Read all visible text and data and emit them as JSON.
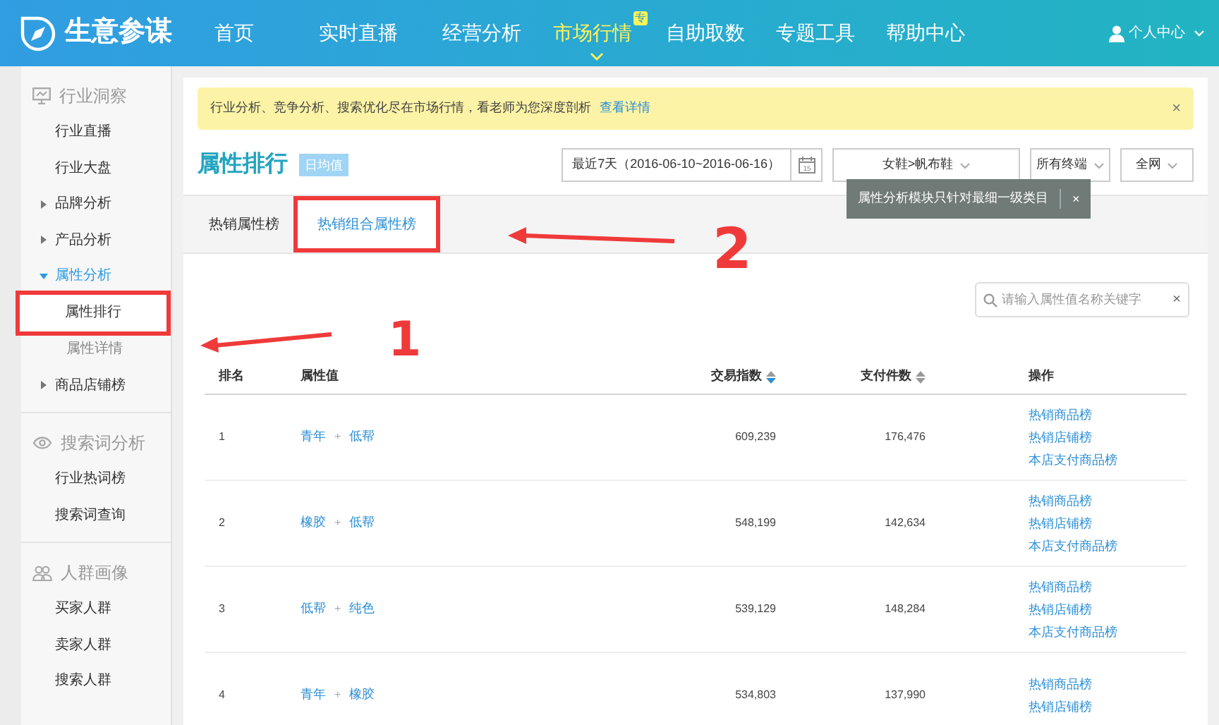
{
  "header": {
    "logo": "生意参谋",
    "nav": [
      {
        "label": "首页",
        "selected": false
      },
      {
        "label": "实时直播",
        "selected": false
      },
      {
        "label": "经营分析",
        "selected": false
      },
      {
        "label": "市场行情",
        "selected": true,
        "badge": "专"
      },
      {
        "label": "自助取数",
        "selected": false
      },
      {
        "label": "专题工具",
        "selected": false
      },
      {
        "label": "帮助中心",
        "selected": false
      }
    ],
    "user": "个人中心"
  },
  "sidebar": {
    "sections": [
      {
        "title": "行业洞察",
        "items": [
          {
            "label": "行业直播"
          },
          {
            "label": "行业大盘"
          },
          {
            "label": "品牌分析",
            "expanded": false
          },
          {
            "label": "产品分析",
            "expanded": false
          },
          {
            "label": "属性分析",
            "expanded": true,
            "children": [
              {
                "label": "属性排行",
                "selected": true,
                "annotated": true
              },
              {
                "label": "属性详情",
                "selected": false,
                "annotated": false
              }
            ]
          },
          {
            "label": "商品店铺榜",
            "expanded": false
          }
        ]
      },
      {
        "title": "搜索词分析",
        "items": [
          {
            "label": "行业热词榜"
          },
          {
            "label": "搜索词查询"
          }
        ]
      },
      {
        "title": "人群画像",
        "items": [
          {
            "label": "买家人群"
          },
          {
            "label": "卖家人群"
          },
          {
            "label": "搜索人群"
          }
        ]
      }
    ]
  },
  "notice": {
    "text": "行业分析、竞争分析、搜索优化尽在市场行情，看老师为您深度剖析",
    "link": "查看详情",
    "close": "×"
  },
  "page": {
    "title": "属性排行",
    "tag": "日均值",
    "date_range": "最近7天（2016-06-10~2016-06-16）",
    "calendar_day": "15",
    "category": "女鞋>帆布鞋",
    "terminal": "所有终端",
    "channel": "全网"
  },
  "tooltip": {
    "text": "属性分析模块只针对最细一级类目",
    "close": "×"
  },
  "tabs": [
    {
      "label": "热销属性榜",
      "selected": false,
      "annotated": false
    },
    {
      "label": "热销组合属性榜",
      "selected": true,
      "annotated": true
    }
  ],
  "search": {
    "placeholder": "请输入属性值名称关键字",
    "clear": "×"
  },
  "table": {
    "columns": [
      {
        "label": "排名"
      },
      {
        "label": "属性值"
      },
      {
        "label": "交易指数",
        "sorted": true
      },
      {
        "label": "支付件数",
        "sorted": false
      },
      {
        "label": "操作"
      }
    ],
    "joiner": "+",
    "rows": [
      {
        "rank": "1",
        "parts": [
          "青年",
          "低帮"
        ],
        "index": "609,239",
        "paid": "176,476",
        "actions": [
          "热销商品榜",
          "热销店铺榜",
          "本店支付商品榜"
        ]
      },
      {
        "rank": "2",
        "parts": [
          "橡胶",
          "低帮"
        ],
        "index": "548,199",
        "paid": "142,634",
        "actions": [
          "热销商品榜",
          "热销店铺榜",
          "本店支付商品榜"
        ]
      },
      {
        "rank": "3",
        "parts": [
          "低帮",
          "纯色"
        ],
        "index": "539,129",
        "paid": "148,284",
        "actions": [
          "热销商品榜",
          "热销店铺榜",
          "本店支付商品榜"
        ]
      },
      {
        "rank": "4",
        "parts": [
          "青年",
          "橡胶"
        ],
        "index": "534,803",
        "paid": "137,990",
        "actions": [
          "热销商品榜",
          "热销店铺榜"
        ]
      }
    ]
  },
  "annotations": [
    {
      "label": "1"
    },
    {
      "label": "2"
    }
  ]
}
